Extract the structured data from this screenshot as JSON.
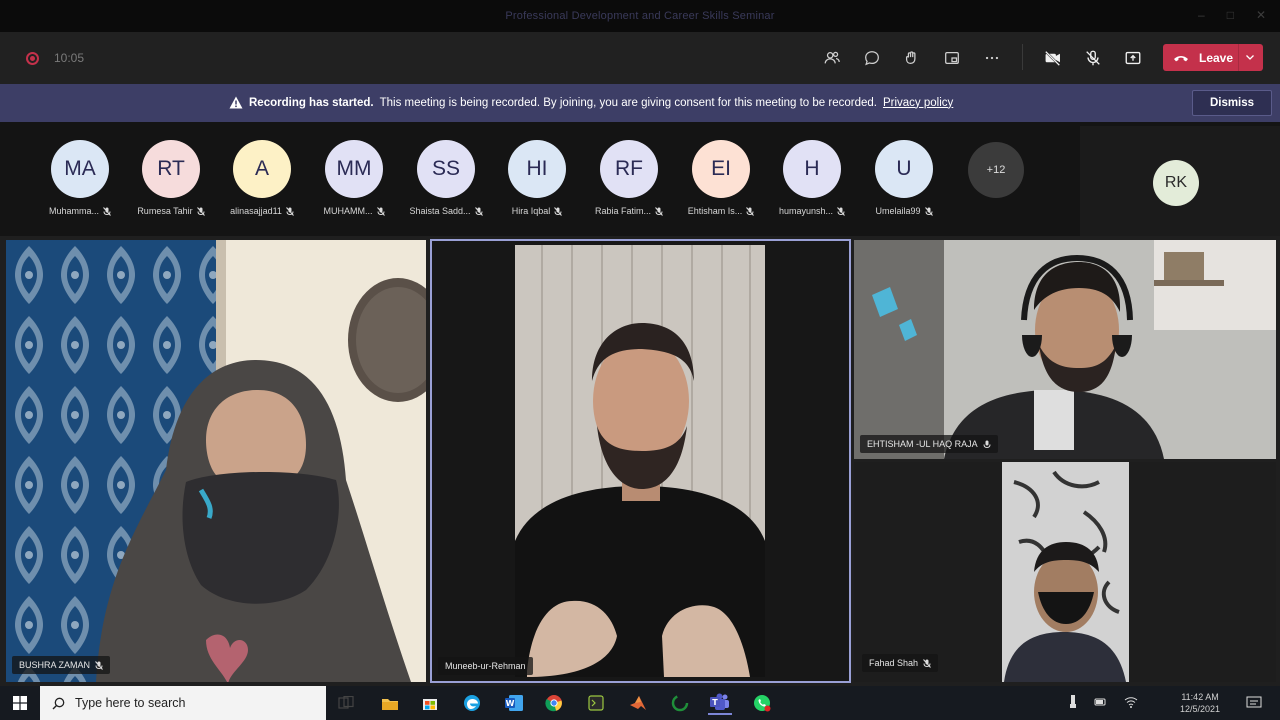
{
  "window": {
    "title": "Professional Development and Career Skills Seminar",
    "controls": [
      "–",
      "□",
      "✕"
    ]
  },
  "meeting": {
    "timer": "10:05",
    "leave_label": "Leave",
    "tools": [
      "people-icon",
      "chat-icon",
      "reactions-icon",
      "rooms-icon",
      "more-icon",
      "camera-off-icon",
      "mic-off-icon",
      "share-icon"
    ]
  },
  "banner": {
    "strong": "Recording has started.",
    "text": "This meeting is being recorded. By joining, you are giving consent for this meeting to be recorded.",
    "link": "Privacy policy",
    "dismiss": "Dismiss"
  },
  "participants": [
    {
      "initials": "MA",
      "name": "Muhamma...",
      "color": "#dbe7f5"
    },
    {
      "initials": "RT",
      "name": "Rumesa Tahir",
      "color": "#f6dcdc"
    },
    {
      "initials": "A",
      "name": "alinasajjad11",
      "color": "#fdf1c6"
    },
    {
      "initials": "MM",
      "name": "MUHAMM...",
      "color": "#e1e1f5"
    },
    {
      "initials": "SS",
      "name": "Shaista Sadd...",
      "color": "#e1e1f5"
    },
    {
      "initials": "HI",
      "name": "Hira Iqbal",
      "color": "#dbe7f5"
    },
    {
      "initials": "RF",
      "name": "Rabia Fatim...",
      "color": "#e1e1f5"
    },
    {
      "initials": "EI",
      "name": "Ehtisham Is...",
      "color": "#fde1d4"
    },
    {
      "initials": "H",
      "name": "humayunsh...",
      "color": "#e1e1f5"
    },
    {
      "initials": "U",
      "name": "Umelaila99",
      "color": "#dbe7f5"
    }
  ],
  "overflow_count": "+12",
  "self_avatar": {
    "initials": "RK",
    "color": "#e3ecd9"
  },
  "videos": {
    "left": "BUSHRA ZAMAN",
    "center": "Muneeb-ur-Rehman",
    "right_top": "EHTISHAM -UL HAQ RAJA",
    "right_bottom": "Fahad Shah"
  },
  "taskbar": {
    "search_placeholder": "Type here to search",
    "tray_time": "11:42 AM",
    "tray_date": "12/5/2021"
  }
}
